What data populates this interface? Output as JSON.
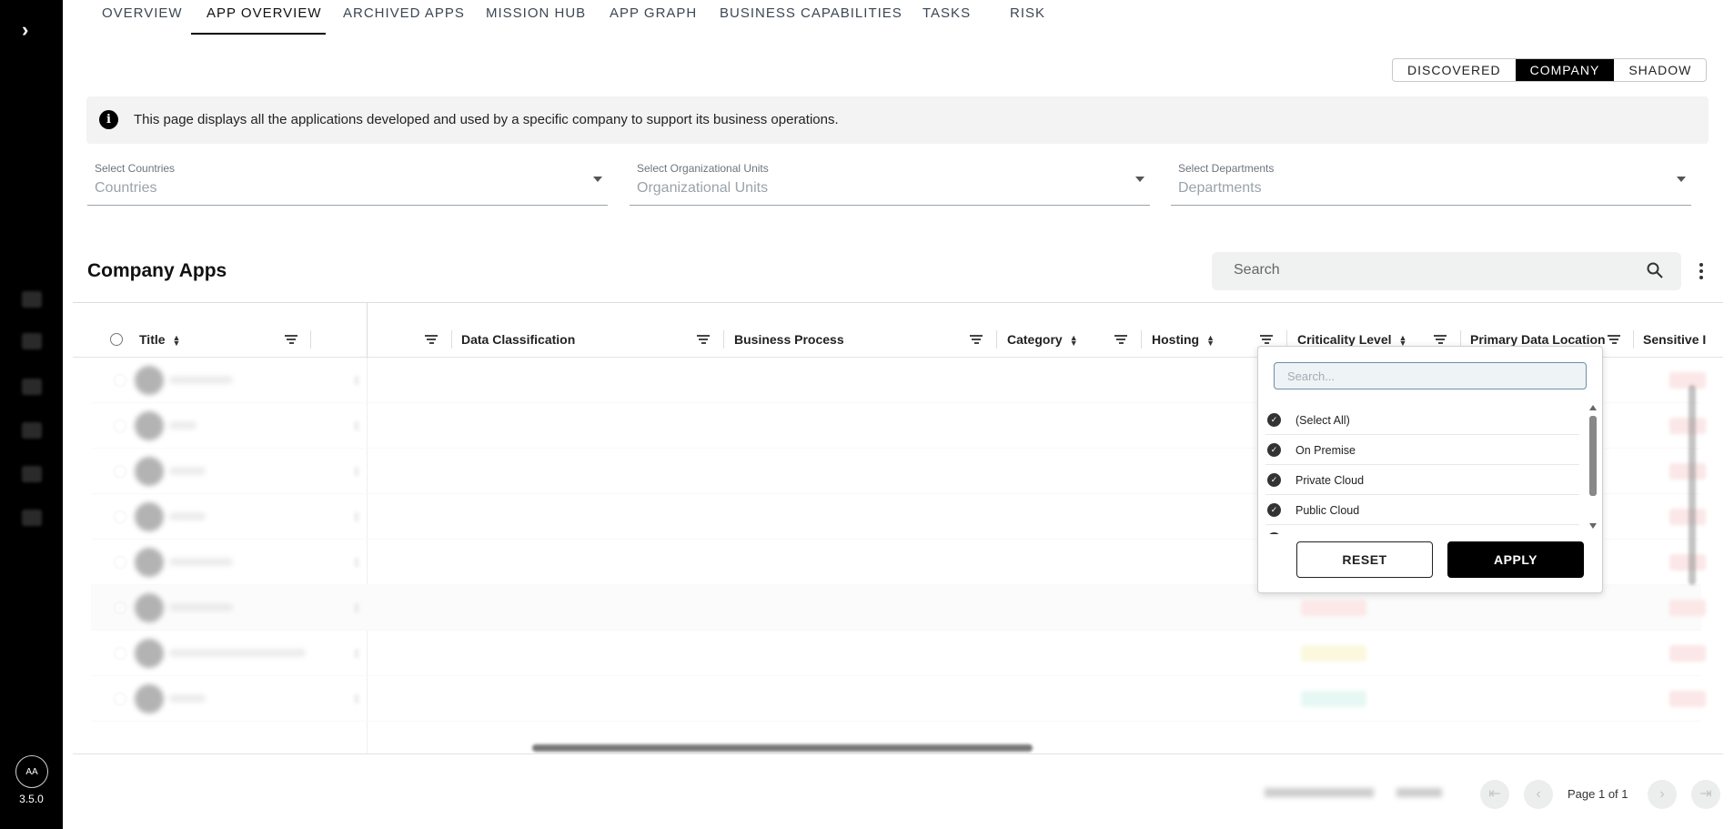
{
  "app": {
    "version": "3.5.0",
    "user_initials": "AA"
  },
  "nav": {
    "tabs": [
      {
        "label": "OVERVIEW"
      },
      {
        "label": "APP OVERVIEW",
        "active": true
      },
      {
        "label": "ARCHIVED APPS"
      },
      {
        "label": "MISSION HUB"
      },
      {
        "label": "APP GRAPH"
      },
      {
        "label": "BUSINESS CAPABILITIES"
      },
      {
        "label": "TASKS"
      },
      {
        "label": "RISK"
      }
    ]
  },
  "segment": {
    "options": [
      "DISCOVERED",
      "COMPANY",
      "SHADOW"
    ],
    "selected": "COMPANY"
  },
  "info_banner": "This page displays all the applications developed and used by a specific company to support its business operations.",
  "filters": [
    {
      "label": "Select Countries",
      "placeholder": "Countries"
    },
    {
      "label": "Select Organizational Units",
      "placeholder": "Organizational Units"
    },
    {
      "label": "Select Departments",
      "placeholder": "Departments"
    }
  ],
  "section_title": "Company Apps",
  "search": {
    "placeholder": "Search"
  },
  "columns": {
    "title": "Title",
    "data_classification": "Data Classification",
    "business_process": "Business Process",
    "category": "Category",
    "hosting": "Hosting",
    "criticality_level": "Criticality Level",
    "primary_data_location": "Primary Data Location",
    "sensitive": "Sensitive I"
  },
  "hosting_filter": {
    "search_placeholder": "Search...",
    "options": [
      "(Select All)",
      "On Premise",
      "Private Cloud",
      "Public Cloud"
    ],
    "reset_label": "RESET",
    "apply_label": "APPLY"
  },
  "pagination": {
    "page_text": "Page 1 of 1"
  },
  "icons": {
    "expand": "chevron-right-icon",
    "info": "info-icon",
    "search": "search-icon",
    "more": "kebab-menu-icon",
    "filter": "filter-icon",
    "sort": "sort-icon",
    "check": "check-circle-icon"
  },
  "colors": {
    "accent": "#000000",
    "banner_bg": "#f2f3f2",
    "popup_input_border": "#6e8fa3"
  }
}
